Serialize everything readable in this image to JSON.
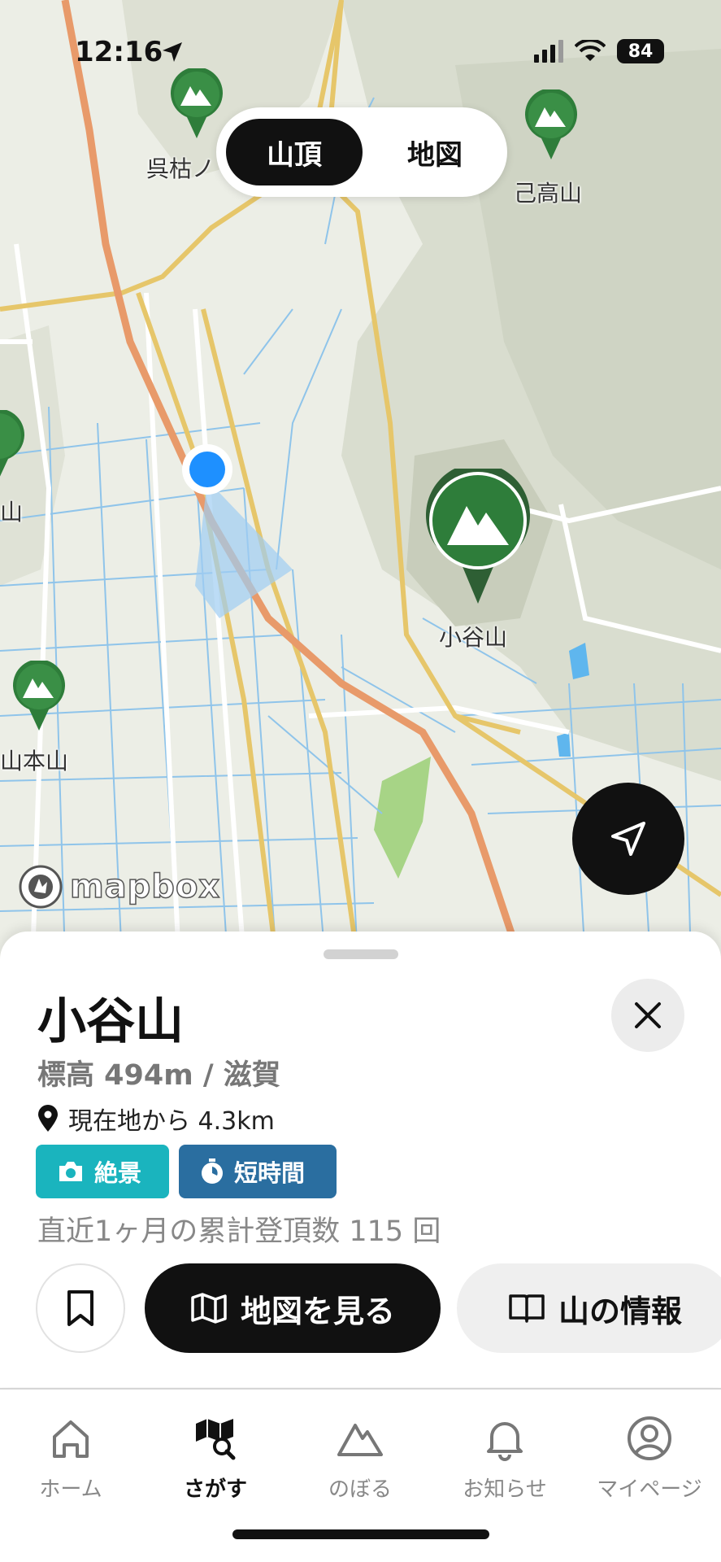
{
  "status_bar": {
    "time": "12:16",
    "battery": "84"
  },
  "map_toggle": {
    "active": "山頂",
    "inactive": "地図"
  },
  "map": {
    "attribution": "mapbox",
    "peaks": [
      {
        "label": "呉枯ノ",
        "icon": "mountain-pin-icon"
      },
      {
        "label": "己高山",
        "icon": "mountain-pin-icon"
      },
      {
        "label": "小谷山",
        "icon": "mountain-pin-selected-icon"
      },
      {
        "label": "山本山",
        "icon": "mountain-pin-icon"
      },
      {
        "label": "山",
        "icon": "mountain-pin-icon"
      }
    ]
  },
  "detail": {
    "title": "小谷山",
    "elevation": "標高 494m / 滋賀",
    "distance": "現在地から 4.3km",
    "tags": [
      {
        "label": "絶景",
        "color": "#1ab4be",
        "icon": "camera-icon"
      },
      {
        "label": "短時間",
        "color": "#2a6ea0",
        "icon": "stopwatch-icon"
      }
    ],
    "summit_count": "直近1ヶ月の累計登頂数 115 回",
    "map_button": "地図を見る",
    "info_button": "山の情報"
  },
  "tabbar": {
    "items": [
      {
        "label": "ホーム",
        "icon": "home-icon",
        "active": false
      },
      {
        "label": "さがす",
        "icon": "map-search-icon",
        "active": true
      },
      {
        "label": "のぼる",
        "icon": "mountain-outline-icon",
        "active": false
      },
      {
        "label": "お知らせ",
        "icon": "bell-icon",
        "active": false
      },
      {
        "label": "マイページ",
        "icon": "user-circle-icon",
        "active": false
      }
    ]
  },
  "colors": {
    "pin_green": "#2e7d3a",
    "accent_black": "#111111",
    "location_blue": "#1e90ff"
  }
}
